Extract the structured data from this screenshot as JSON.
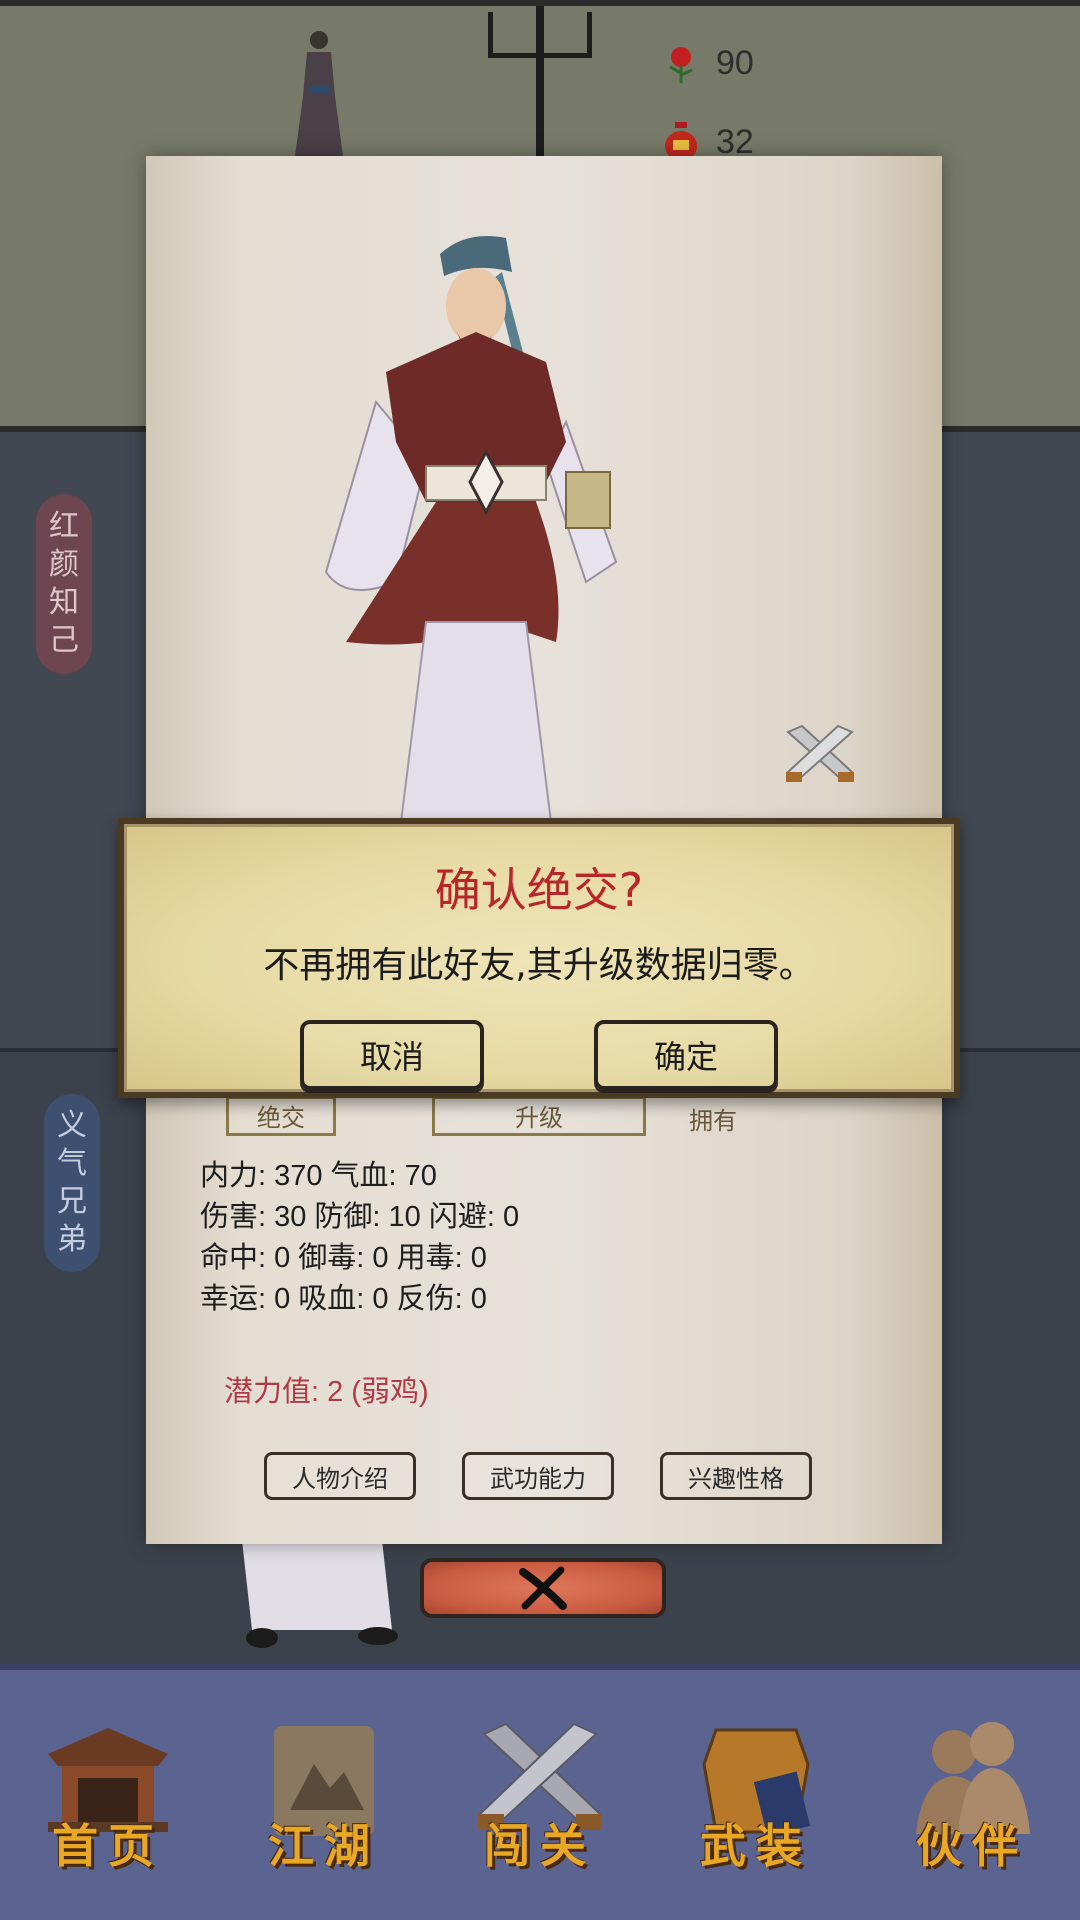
{
  "resources": {
    "roses": "90",
    "wine": "32"
  },
  "side_banners": {
    "red": [
      "红",
      "颜",
      "知",
      "己"
    ],
    "blue": [
      "义",
      "气",
      "兄",
      "弟"
    ]
  },
  "card": {
    "hidden_buttons": [
      "绝交",
      "升级",
      "拥有"
    ],
    "stats": [
      "内力: 370 气血: 70",
      "伤害: 30 防御: 10 闪避: 0",
      "命中: 0 御毒: 0 用毒: 0",
      "幸运: 0 吸血: 0 反伤: 0"
    ],
    "potential": "潜力值: 2 (弱鸡)",
    "tabs": [
      "人物介绍",
      "武功能力",
      "兴趣性格"
    ]
  },
  "dialog": {
    "title": "确认绝交?",
    "message": "不再拥有此好友,其升级数据归零。",
    "cancel_label": "取消",
    "confirm_label": "确定"
  },
  "bottom_nav": [
    {
      "label": "首页",
      "icon": "home-hall-icon"
    },
    {
      "label": "江湖",
      "icon": "world-scroll-icon"
    },
    {
      "label": "闯关",
      "icon": "crossed-swords-icon"
    },
    {
      "label": "武装",
      "icon": "armor-icon"
    },
    {
      "label": "伙伴",
      "icon": "partners-icon"
    }
  ],
  "colors": {
    "dialog_title": "#b8262a",
    "potential": "#b03a48",
    "nav_label": "#e8a826",
    "close_button": "#c85a40"
  }
}
